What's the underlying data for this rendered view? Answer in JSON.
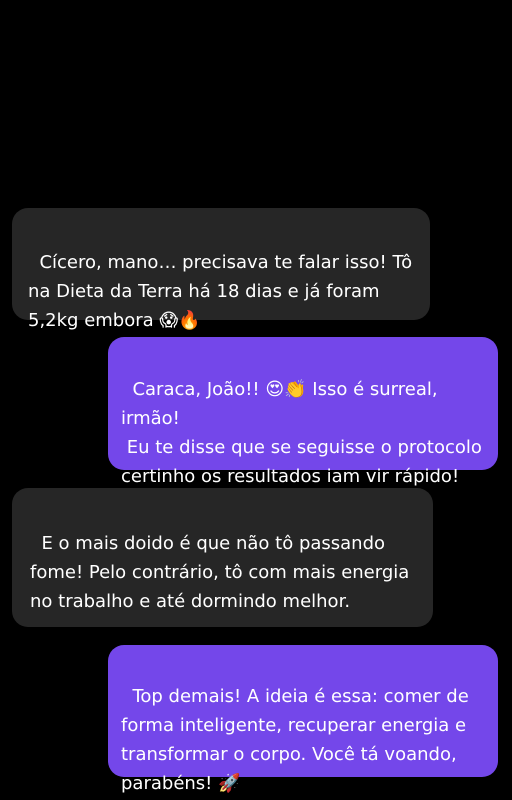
{
  "colors": {
    "background": "#000000",
    "received_bubble": "#262626",
    "sent_bubble": "#7447ea",
    "text": "#ffffff"
  },
  "messages": [
    {
      "direction": "received",
      "text": "Cícero, mano… precisava te falar isso! Tô na Dieta da Terra há 18 dias e já foram 5,2kg embora 😱🔥"
    },
    {
      "direction": "sent",
      "text": "Caraca, João!! 😍👏 Isso é surreal, irmão!\n Eu te disse que se seguisse o protocolo certinho os resultados iam vir rápido!"
    },
    {
      "direction": "received",
      "text": "E o mais doido é que não tô passando fome! Pelo contrário, tô com mais energia no trabalho e até dormindo melhor."
    },
    {
      "direction": "sent",
      "text": "Top demais! A ideia é essa: comer de forma inteligente, recuperar energia e transformar o corpo. Você tá voando, parabéns! 🚀"
    }
  ]
}
